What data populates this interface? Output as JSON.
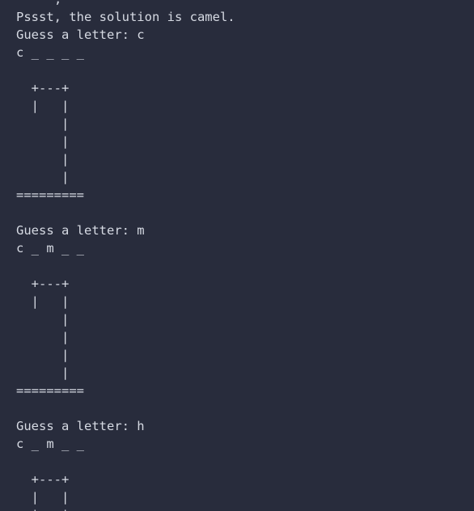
{
  "terminal": {
    "fragment": ",",
    "lines": [
      "Pssst, the solution is camel.",
      "Guess a letter: c",
      "c _ _ _ _",
      "",
      "  +---+",
      "  |   |",
      "      |",
      "      |",
      "      |",
      "      |",
      "=========",
      "",
      "Guess a letter: m",
      "c _ m _ _",
      "",
      "  +---+",
      "  |   |",
      "      |",
      "      |",
      "      |",
      "      |",
      "=========",
      "",
      "Guess a letter: h",
      "c _ m _ _",
      "",
      "  +---+",
      "  |   |",
      "  |   |"
    ]
  }
}
